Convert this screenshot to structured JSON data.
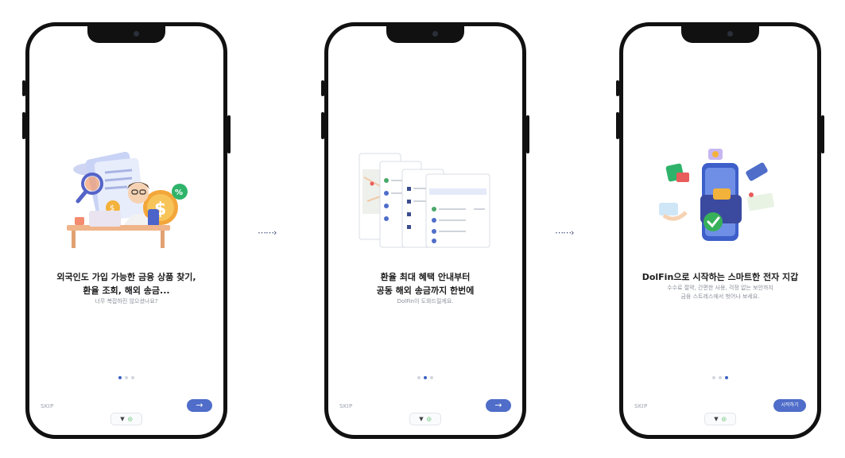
{
  "screens": [
    {
      "title_lines": [
        "외국인도 가입 가능한 금융 상품 찾기,",
        "환율 조회, 해외 송금..."
      ],
      "subtitle_lines": [
        "너무 복잡하진 않으셨나요?"
      ],
      "page_index": 1,
      "skip_label": "SKIP",
      "button_label": "→",
      "button_icon": "arrow-right-icon"
    },
    {
      "title_lines": [
        "환율 최대 혜택 안내부터",
        "공동 해외 송금까지 한번에"
      ],
      "subtitle_lines": [
        "DolFin이 도와드릴게요."
      ],
      "page_index": 2,
      "skip_label": "SKIP",
      "button_label": "→",
      "button_icon": "arrow-right-icon"
    },
    {
      "title_lines": [
        "DolFin으로 시작하는 스마트한 전자 지갑"
      ],
      "subtitle_lines": [
        "수수료 절약, 간편한 사용, 걱정 없는 보안까지",
        "금융 스트레스에서 벗어나 보세요."
      ],
      "page_index": 3,
      "skip_label": "SKIP",
      "button_label": "시작하기",
      "button_icon": ""
    }
  ],
  "pagination_total": 3,
  "connector_arrow": "⋯⋯›",
  "homebar_icons": [
    "back-triangle-icon",
    "home-circle-icon"
  ],
  "colors": {
    "accent": "#4f6dc9",
    "active_dot": "#3b63c4",
    "inactive_dot": "#d2d6de",
    "frame": "#111111"
  }
}
